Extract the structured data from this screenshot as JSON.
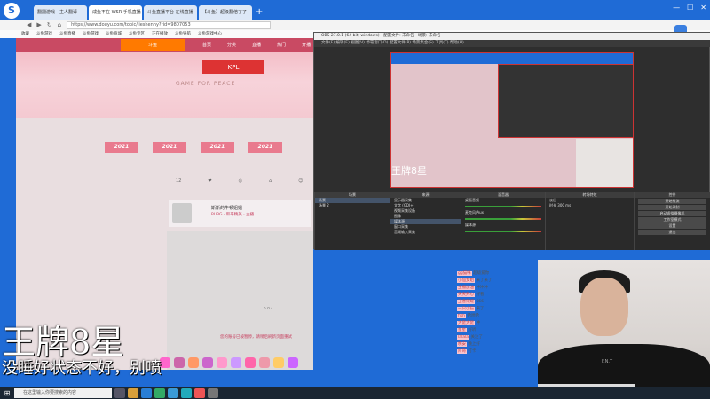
{
  "browser": {
    "logo_letter": "S",
    "tabs": [
      "翻翻游戏 - 主人翻译",
      "咸鱼不在 WSR 手机直播",
      "斗鱼直播平台 在线直播",
      "【斗鱼】超级翻倍了了",
      "+"
    ],
    "window_controls": [
      "—",
      "☐",
      "✕"
    ],
    "url": "https://www.douyu.com/topic/lieshenhy?rid=9807053",
    "bookmarks": [
      "收藏",
      "斗鱼游戏",
      "斗鱼直播",
      "斗鱼游戏",
      "斗鱼商城",
      "斗鱼专区",
      "正在播放",
      "斗鱼导航",
      "斗鱼游戏中心"
    ]
  },
  "page": {
    "nav_items": [
      "首页",
      "分类",
      "直播",
      "热门",
      "开播"
    ],
    "douyu_logo": "斗鱼",
    "kpl_label": "KPL",
    "slogan": "GAME FOR PEACE",
    "badges": [
      "2021",
      "2021",
      "2021",
      "2021"
    ],
    "stats": [
      "12",
      "❤",
      "◎",
      "⌂",
      "☺"
    ],
    "anchor_name": "斯斯的牛顿姐姐",
    "anchor_sub": "PUBG · 和平精英 · 主播",
    "player_note": "您的账号已被暂停，请稍后刷新页面重试"
  },
  "chat": {
    "lines": [
      {
        "user": "gg猫咪",
        "text": "超级爱你"
      },
      {
        "user": "小仙女姐",
        "text": "来了来了"
      },
      {
        "user": "主播加油",
        "text": "冲冲冲"
      },
      {
        "user": "天天开心",
        "text": "好看"
      },
      {
        "user": "王者荣耀",
        "text": "666"
      },
      {
        "user": "一只小猫",
        "text": "来了"
      },
      {
        "user": "fish",
        "text": "哈哈哈"
      },
      {
        "user": "大佬大佬",
        "text": "冲"
      },
      {
        "user": "星星",
        "text": "好听"
      },
      {
        "user": "lalala",
        "text": "关注了"
      },
      {
        "user": "晚安",
        "text": "晚上好"
      },
      {
        "user": "阿哥",
        "text": "打卡"
      }
    ]
  },
  "obs": {
    "title": "OBS 27.0.1 (64-bit, windows) - 配置文件: 未命名 - 场景: 未命名",
    "menu": "文件(F)  编辑(E)  视图(V)  停靠窗口(D)  配置文件(P)  场景集合(S)  工具(T)  帮助(H)",
    "preview_watermark": "王牌8星",
    "panels": {
      "scenes": {
        "header": "场景",
        "items": [
          "场景",
          "场景 2"
        ]
      },
      "sources": {
        "header": "来源",
        "items": [
          "显示器采集",
          "文字 (GDI+)",
          "视频采集设备",
          "图像",
          "媒体源",
          "窗口采集",
          "音频输入采集"
        ]
      },
      "mixer": {
        "header": "混音器",
        "items": [
          "桌面音频",
          "麦克风/Aux",
          "媒体源"
        ]
      },
      "transitions": {
        "header": "转场特效",
        "items": [
          "淡出",
          "时长 300 ms"
        ]
      },
      "controls": {
        "header": "控件",
        "items": [
          "开始推流",
          "开始录制",
          "启动虚拟摄像机",
          "工作室模式",
          "设置",
          "退出"
        ]
      }
    }
  },
  "overlay": {
    "watermark": "王牌8星",
    "subtitle": "没睡好状态不好，别喷",
    "shirt_logo": "F.N.T"
  },
  "taskbar": {
    "start": "⊞",
    "search_placeholder": "在这里输入你要搜索的内容"
  },
  "colors": {
    "browser_blue": "#1f6bd6",
    "douyu_orange": "#ff7a00",
    "obs_dark": "#2e2e2e",
    "pink_brand": "#c94a63"
  }
}
